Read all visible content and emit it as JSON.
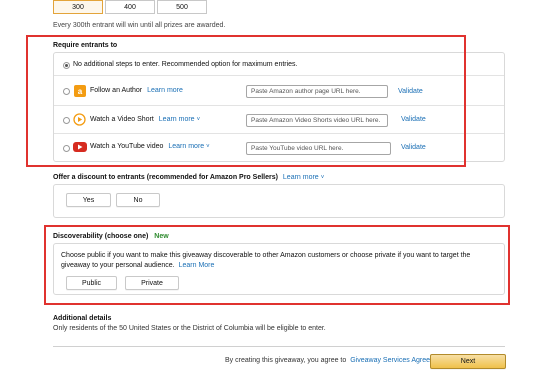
{
  "entrant_options": {
    "buttons": [
      "300",
      "400",
      "500"
    ],
    "selected": "300",
    "note": "Every 300th entrant will win until all prizes are awarded."
  },
  "require_entrants": {
    "title": "Require entrants to",
    "options": [
      {
        "label": "No additional steps to enter. Recommended option for maximum entries.",
        "checked": true
      },
      {
        "label": "Follow an Author",
        "learn_more": "Learn more",
        "placeholder": "Paste Amazon author page URL here.",
        "validate": "Validate",
        "icon": "amazon-a-icon"
      },
      {
        "label": "Watch a Video Short",
        "learn_more": "Learn more",
        "placeholder": "Paste Amazon Video Shorts video URL here.",
        "validate": "Validate",
        "icon": "play-circle-icon"
      },
      {
        "label": "Watch a YouTube video",
        "learn_more": "Learn more",
        "placeholder": "Paste YouTube video URL here.",
        "validate": "Validate",
        "icon": "youtube-icon"
      }
    ]
  },
  "discount": {
    "title": "Offer a discount to entrants (recommended for Amazon Pro Sellers)",
    "learn_more": "Learn more",
    "buttons": [
      "Yes",
      "No"
    ]
  },
  "discoverability": {
    "title": "Discoverability (choose one)",
    "badge": "New",
    "description": "Choose public if you want to make this giveaway discoverable to other Amazon customers or choose private if you want to target the giveaway to your personal audience.",
    "learn_more": "Learn More",
    "buttons": [
      "Public",
      "Private"
    ]
  },
  "additional": {
    "title": "Additional details",
    "text": "Only residents of the 50 United States or the District of Columbia will be eligible to enter."
  },
  "footer": {
    "agree_text": "By creating this giveaway, you agree to",
    "agreement_link": "Giveaway Services Agreement",
    "next": "Next"
  },
  "colors": {
    "highlight": "#e0322f",
    "link": "#1a6fb5",
    "new_badge": "#2e8b2e",
    "primary_button": "#f0c14b"
  }
}
